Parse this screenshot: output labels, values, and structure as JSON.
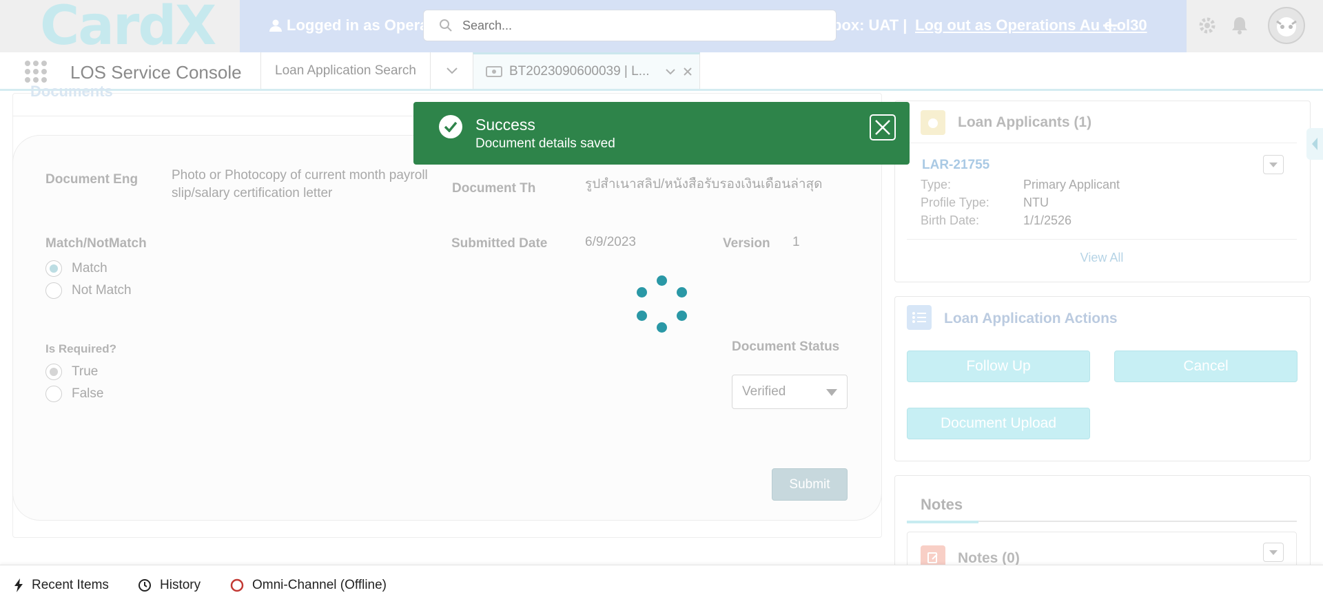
{
  "header": {
    "logo": "CardX",
    "logged_in_text": "Logged in as Opera",
    "sandbox_text": "box: UAT |",
    "logout_link": "Log out as Operations Au  e.ol30",
    "search_placeholder": "Search...",
    "icons": [
      "search-icon",
      "add-icon",
      "gear-icon",
      "bell-icon",
      "avatar"
    ]
  },
  "nav": {
    "app_name": "LOS Service Console",
    "tabs": [
      {
        "label": "Loan Application Search"
      },
      {
        "label": "BT2023090600039 | L..."
      }
    ]
  },
  "document": {
    "section_title": "Documents",
    "doc_eng_label": "Document Eng",
    "doc_eng_value": "Photo or Photocopy of current month payroll slip/salary certification letter",
    "doc_th_label": "Document Th",
    "doc_th_value": "รูปสำเนาสลิป/หนังสือรับรองเงินเดือนล่าสุด",
    "match_label": "Match/NotMatch",
    "match_options": [
      "Match",
      "Not Match"
    ],
    "match_selected": "Match",
    "submitted_label": "Submitted Date",
    "submitted_value": "6/9/2023",
    "version_label": "Version",
    "version_value": "1",
    "required_label": "Is Required?",
    "required_options": [
      "True",
      "False"
    ],
    "required_selected": "True",
    "status_label": "Document Status",
    "status_value": "Verified",
    "submit_label": "Submit"
  },
  "toast": {
    "title": "Success",
    "message": "Document details saved",
    "color": "#2e844a"
  },
  "applicants": {
    "title": "Loan Applicants (1)",
    "record": "LAR-21755",
    "type_label": "Type:",
    "type_value": "Primary Applicant",
    "profile_label": "Profile Type:",
    "profile_value": "NTU",
    "birth_label": "Birth Date:",
    "birth_value": "1/1/2526",
    "view_all": "View All"
  },
  "actions": {
    "title": "Loan Application Actions",
    "follow_up": "Follow Up",
    "cancel": "Cancel",
    "upload": "Document Upload"
  },
  "notes": {
    "tab_label": "Notes",
    "card_title": "Notes (0)"
  },
  "utility": {
    "recent": "Recent Items",
    "history": "History",
    "omni": "Omni-Channel (Offline)"
  }
}
